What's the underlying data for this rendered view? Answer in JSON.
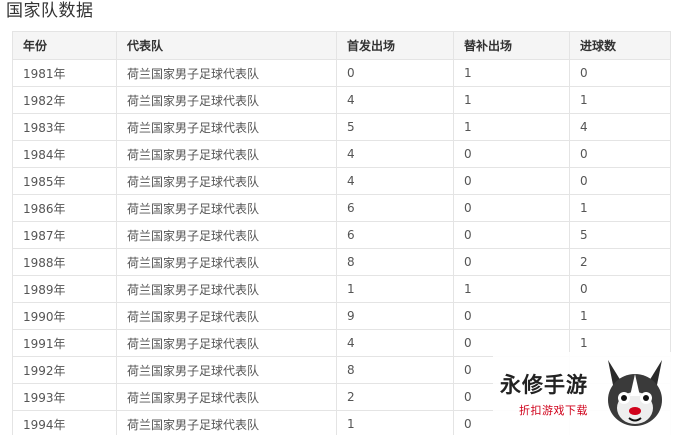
{
  "section": {
    "title": "国家队数据"
  },
  "table": {
    "headers": [
      "年份",
      "代表队",
      "首发出场",
      "替补出场",
      "进球数"
    ],
    "rows": [
      [
        "1981年",
        "荷兰国家男子足球代表队",
        "0",
        "1",
        "0"
      ],
      [
        "1982年",
        "荷兰国家男子足球代表队",
        "4",
        "1",
        "1"
      ],
      [
        "1983年",
        "荷兰国家男子足球代表队",
        "5",
        "1",
        "4"
      ],
      [
        "1984年",
        "荷兰国家男子足球代表队",
        "4",
        "0",
        "0"
      ],
      [
        "1985年",
        "荷兰国家男子足球代表队",
        "4",
        "0",
        "0"
      ],
      [
        "1986年",
        "荷兰国家男子足球代表队",
        "6",
        "0",
        "1"
      ],
      [
        "1987年",
        "荷兰国家男子足球代表队",
        "6",
        "0",
        "5"
      ],
      [
        "1988年",
        "荷兰国家男子足球代表队",
        "8",
        "0",
        "2"
      ],
      [
        "1989年",
        "荷兰国家男子足球代表队",
        "1",
        "1",
        "0"
      ],
      [
        "1990年",
        "荷兰国家男子足球代表队",
        "9",
        "0",
        "1"
      ],
      [
        "1991年",
        "荷兰国家男子足球代表队",
        "4",
        "0",
        "1"
      ],
      [
        "1992年",
        "荷兰国家男子足球代表队",
        "8",
        "0",
        ""
      ],
      [
        "1993年",
        "荷兰国家男子足球代表队",
        "2",
        "0",
        ""
      ],
      [
        "1994年",
        "荷兰国家男子足球代表队",
        "1",
        "0",
        ""
      ]
    ]
  },
  "watermark": {
    "title": "永修手游",
    "subtitle": "折扣游戏下载",
    "icon": "mascot-icon"
  },
  "colors": {
    "header_bg": "#f5f5f5",
    "border": "#e4e4e4",
    "accent_red": "#d0021b"
  }
}
